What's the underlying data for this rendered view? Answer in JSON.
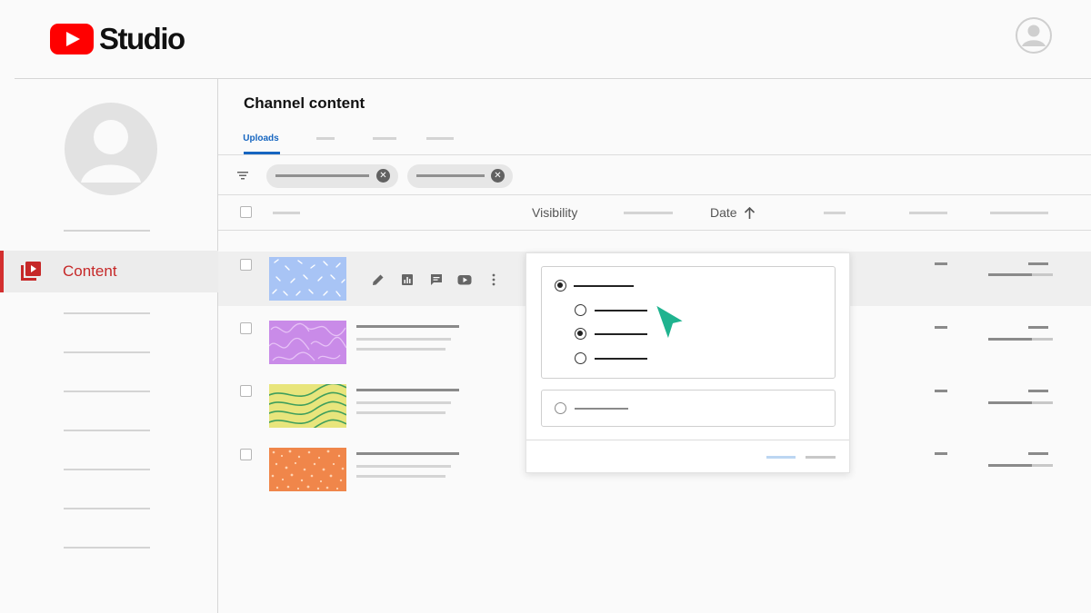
{
  "app": {
    "logo_text": "Studio",
    "logo_icon": "youtube-play-icon",
    "brand_color": "#ff0000"
  },
  "sidebar": {
    "active_item": {
      "label": "Content",
      "icon": "video-library-icon",
      "color": "#c62828"
    }
  },
  "main": {
    "title": "Channel content",
    "tabs": [
      {
        "label": "Uploads",
        "active": true
      },
      {
        "label": ""
      },
      {
        "label": ""
      },
      {
        "label": ""
      }
    ],
    "columns": {
      "visibility": "Visibility",
      "date": "Date"
    },
    "accent_color": "#1565c0"
  },
  "popup": {
    "options_selected": "nested-option-2",
    "cursor_color": "#1fb38f"
  }
}
